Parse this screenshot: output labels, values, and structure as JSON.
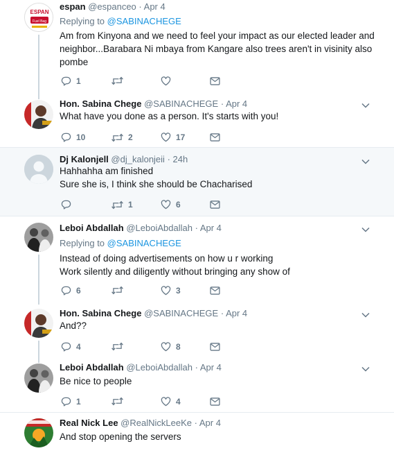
{
  "tweets": [
    {
      "name": "espan",
      "handle": "@espanceo",
      "date": "Apr 4",
      "replying_label": "Replying to",
      "replying_to": "@SABINACHEGE",
      "lines": [
        "Am from Kinyona and we need to feel your impact as our elected leader and",
        "neighbor...Barabara Ni mbaya from Kangare also trees aren't in visinity also",
        "pombe"
      ],
      "reply_count": "1",
      "retweet_count": "",
      "like_count": ""
    },
    {
      "name": "Hon. Sabina Chege",
      "handle": "@SABINACHEGE",
      "date": "Apr 4",
      "lines": [
        "What have you done as a person. It's starts with you!"
      ],
      "reply_count": "10",
      "retweet_count": "2",
      "like_count": "17"
    },
    {
      "name": "Dj Kalonjell",
      "handle": "@dj_kalonjeii",
      "date": "24h",
      "lines": [
        "Hahhahha am finished",
        "Sure she is, I think she should be Chacharised"
      ],
      "reply_count": "",
      "retweet_count": "1",
      "like_count": "6"
    },
    {
      "name": "Leboi Abdallah",
      "handle": "@LeboiAbdallah",
      "date": "Apr 4",
      "replying_label": "Replying to",
      "replying_to": "@SABINACHEGE",
      "lines": [
        "Instead of doing advertisements on how u r working",
        "Work silently and diligently without bringing any show of"
      ],
      "reply_count": "6",
      "retweet_count": "",
      "like_count": "3"
    },
    {
      "name": "Hon. Sabina Chege",
      "handle": "@SABINACHEGE",
      "date": "Apr 4",
      "lines": [
        "And??"
      ],
      "reply_count": "4",
      "retweet_count": "",
      "like_count": "8"
    },
    {
      "name": "Leboi Abdallah",
      "handle": "@LeboiAbdallah",
      "date": "Apr 4",
      "lines": [
        "Be nice to people"
      ],
      "reply_count": "1",
      "retweet_count": "",
      "like_count": "4"
    },
    {
      "name": "Real Nick Lee",
      "handle": "@RealNickLeeKe",
      "date": "Apr 4",
      "lines": [
        "And stop opening the servers"
      ]
    }
  ],
  "avatar1_text": [
    "ESPAN",
    "Fuel Bag"
  ],
  "dot": "·"
}
